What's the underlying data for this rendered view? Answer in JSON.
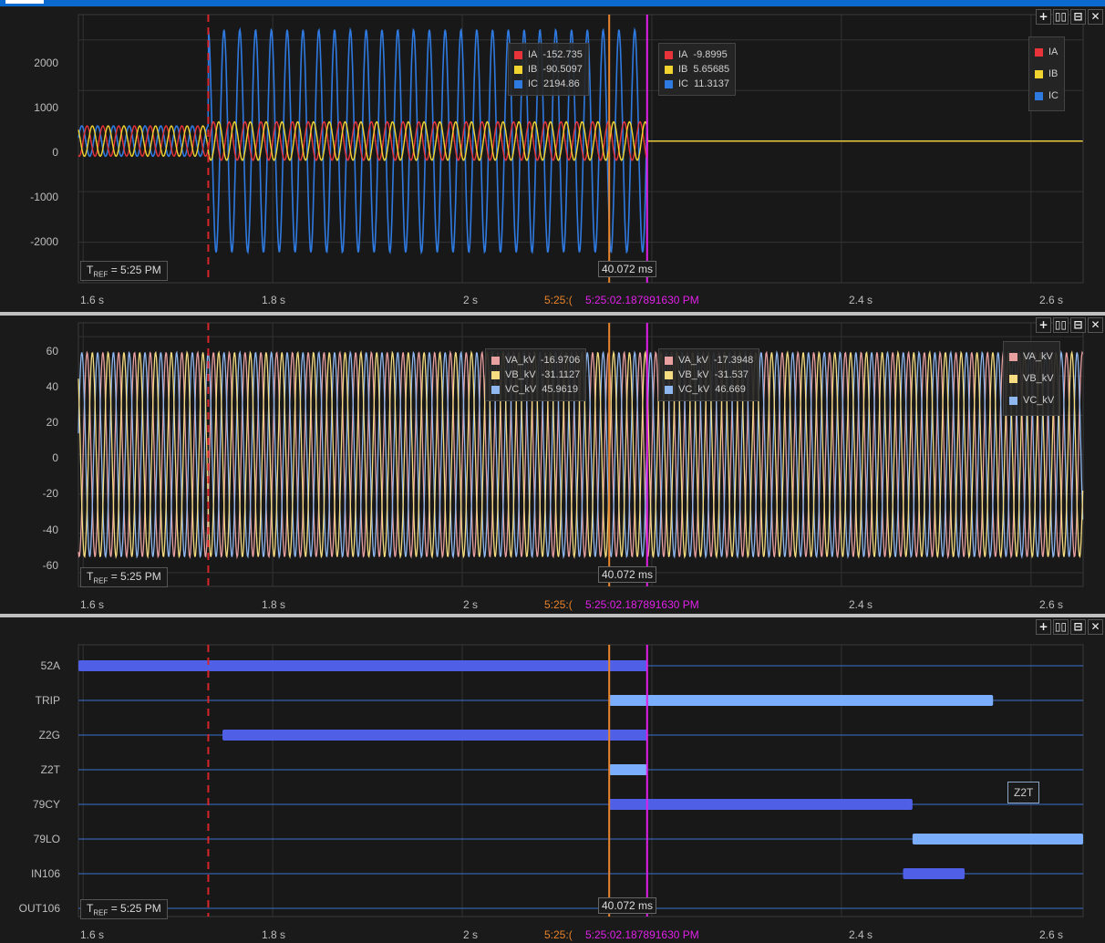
{
  "panel_buttons": [
    "+",
    "▯▯",
    "⊟",
    "✕"
  ],
  "tref_label": "= 5:25 PM",
  "tref_prefix": "T",
  "tref_sub": "REF",
  "delta_label": "40.072 ms",
  "cursor_time_orange": "5:25:(",
  "cursor_time_magenta": "5:25:02.187891630 PM",
  "x_ticks": [
    "1.6 s",
    "1.8 s",
    "2 s",
    "2.4 s",
    "2.6 s"
  ],
  "colors": {
    "ia": "#e8333a",
    "ib": "#f2d430",
    "ic": "#2f7ae0",
    "va": "#e8a0a0",
    "vb": "#f5dc80",
    "vc": "#90b8f0",
    "digital_dark": "#4f5fe6",
    "digital_light": "#7aaefc",
    "cursor_red": "#d8252b",
    "cursor_orange": "#e8842b",
    "cursor_magenta": "#e020e8"
  },
  "chart_data": [
    {
      "type": "line",
      "yticks": [
        "2000",
        "1000",
        "0",
        "-1000",
        "-2000"
      ],
      "ylim": [
        -2800,
        2500
      ],
      "xlim": [
        1.595,
        2.655
      ],
      "series": [
        {
          "name": "IA",
          "amplitude_pre_fault": 300,
          "amplitude_fault": 380,
          "after_breaker_open": 0
        },
        {
          "name": "IB",
          "amplitude_pre_fault": 300,
          "amplitude_fault": 380,
          "after_breaker_open": 0
        },
        {
          "name": "IC",
          "amplitude_pre_fault": 300,
          "amplitude_fault": 2200,
          "after_breaker_open": 0
        }
      ],
      "events": {
        "fault_start": 1.732,
        "cursor_orange": 2.155,
        "cursor_magenta": 2.195
      },
      "legend": {
        "items": [
          "IA",
          "IB",
          "IC"
        ],
        "placement": "top-right"
      },
      "cursor_readouts": [
        {
          "cursor": "orange",
          "values": [
            {
              "name": "IA",
              "value": "-152.735"
            },
            {
              "name": "IB",
              "value": "-90.5097"
            },
            {
              "name": "IC",
              "value": "2194.86"
            }
          ]
        },
        {
          "cursor": "magenta",
          "values": [
            {
              "name": "IA",
              "value": "-9.8995"
            },
            {
              "name": "IB",
              "value": "5.65685"
            },
            {
              "name": "IC",
              "value": "11.3137"
            }
          ]
        }
      ]
    },
    {
      "type": "line",
      "yticks": [
        "60",
        "40",
        "20",
        "0",
        "-20",
        "-40",
        "-60"
      ],
      "ylim": [
        -67,
        67
      ],
      "xlim": [
        1.595,
        2.655
      ],
      "series": [
        {
          "name": "VA_kV",
          "amplitude": 52
        },
        {
          "name": "VB_kV",
          "amplitude": 52
        },
        {
          "name": "VC_kV",
          "amplitude": 52
        }
      ],
      "legend": {
        "items": [
          "VA_kV",
          "VB_kV",
          "VC_kV"
        ],
        "placement": "top-right"
      },
      "cursor_readouts": [
        {
          "cursor": "orange",
          "values": [
            {
              "name": "VA_kV",
              "value": "-16.9706"
            },
            {
              "name": "VB_kV",
              "value": "-31.1127"
            },
            {
              "name": "VC_kV",
              "value": "45.9619"
            }
          ]
        },
        {
          "cursor": "magenta",
          "values": [
            {
              "name": "VA_kV",
              "value": "-17.3948"
            },
            {
              "name": "VB_kV",
              "value": "-31.537"
            },
            {
              "name": "VC_kV",
              "value": "46.669"
            }
          ]
        }
      ]
    },
    {
      "type": "digital",
      "xlim": [
        1.595,
        2.655
      ],
      "channels": [
        {
          "name": "52A",
          "on": [
            [
              1.595,
              2.195
            ]
          ],
          "tone": "dark"
        },
        {
          "name": "TRIP",
          "on": [
            [
              2.155,
              2.56
            ]
          ],
          "tone": "light"
        },
        {
          "name": "Z2G",
          "on": [
            [
              1.747,
              2.195
            ]
          ],
          "tone": "dark"
        },
        {
          "name": "Z2T",
          "on": [
            [
              2.155,
              2.195
            ]
          ],
          "tone": "light"
        },
        {
          "name": "79CY",
          "on": [
            [
              2.155,
              2.475
            ]
          ],
          "tone": "dark"
        },
        {
          "name": "79LO",
          "on": [
            [
              2.475,
              2.655
            ]
          ],
          "tone": "light"
        },
        {
          "name": "IN106",
          "on": [
            [
              2.465,
              2.53
            ]
          ],
          "tone": "dark"
        },
        {
          "name": "OUT106",
          "on": [
            [
              2.195,
              2.2
            ]
          ],
          "tone": "light"
        }
      ],
      "tag": "Z2T"
    }
  ]
}
